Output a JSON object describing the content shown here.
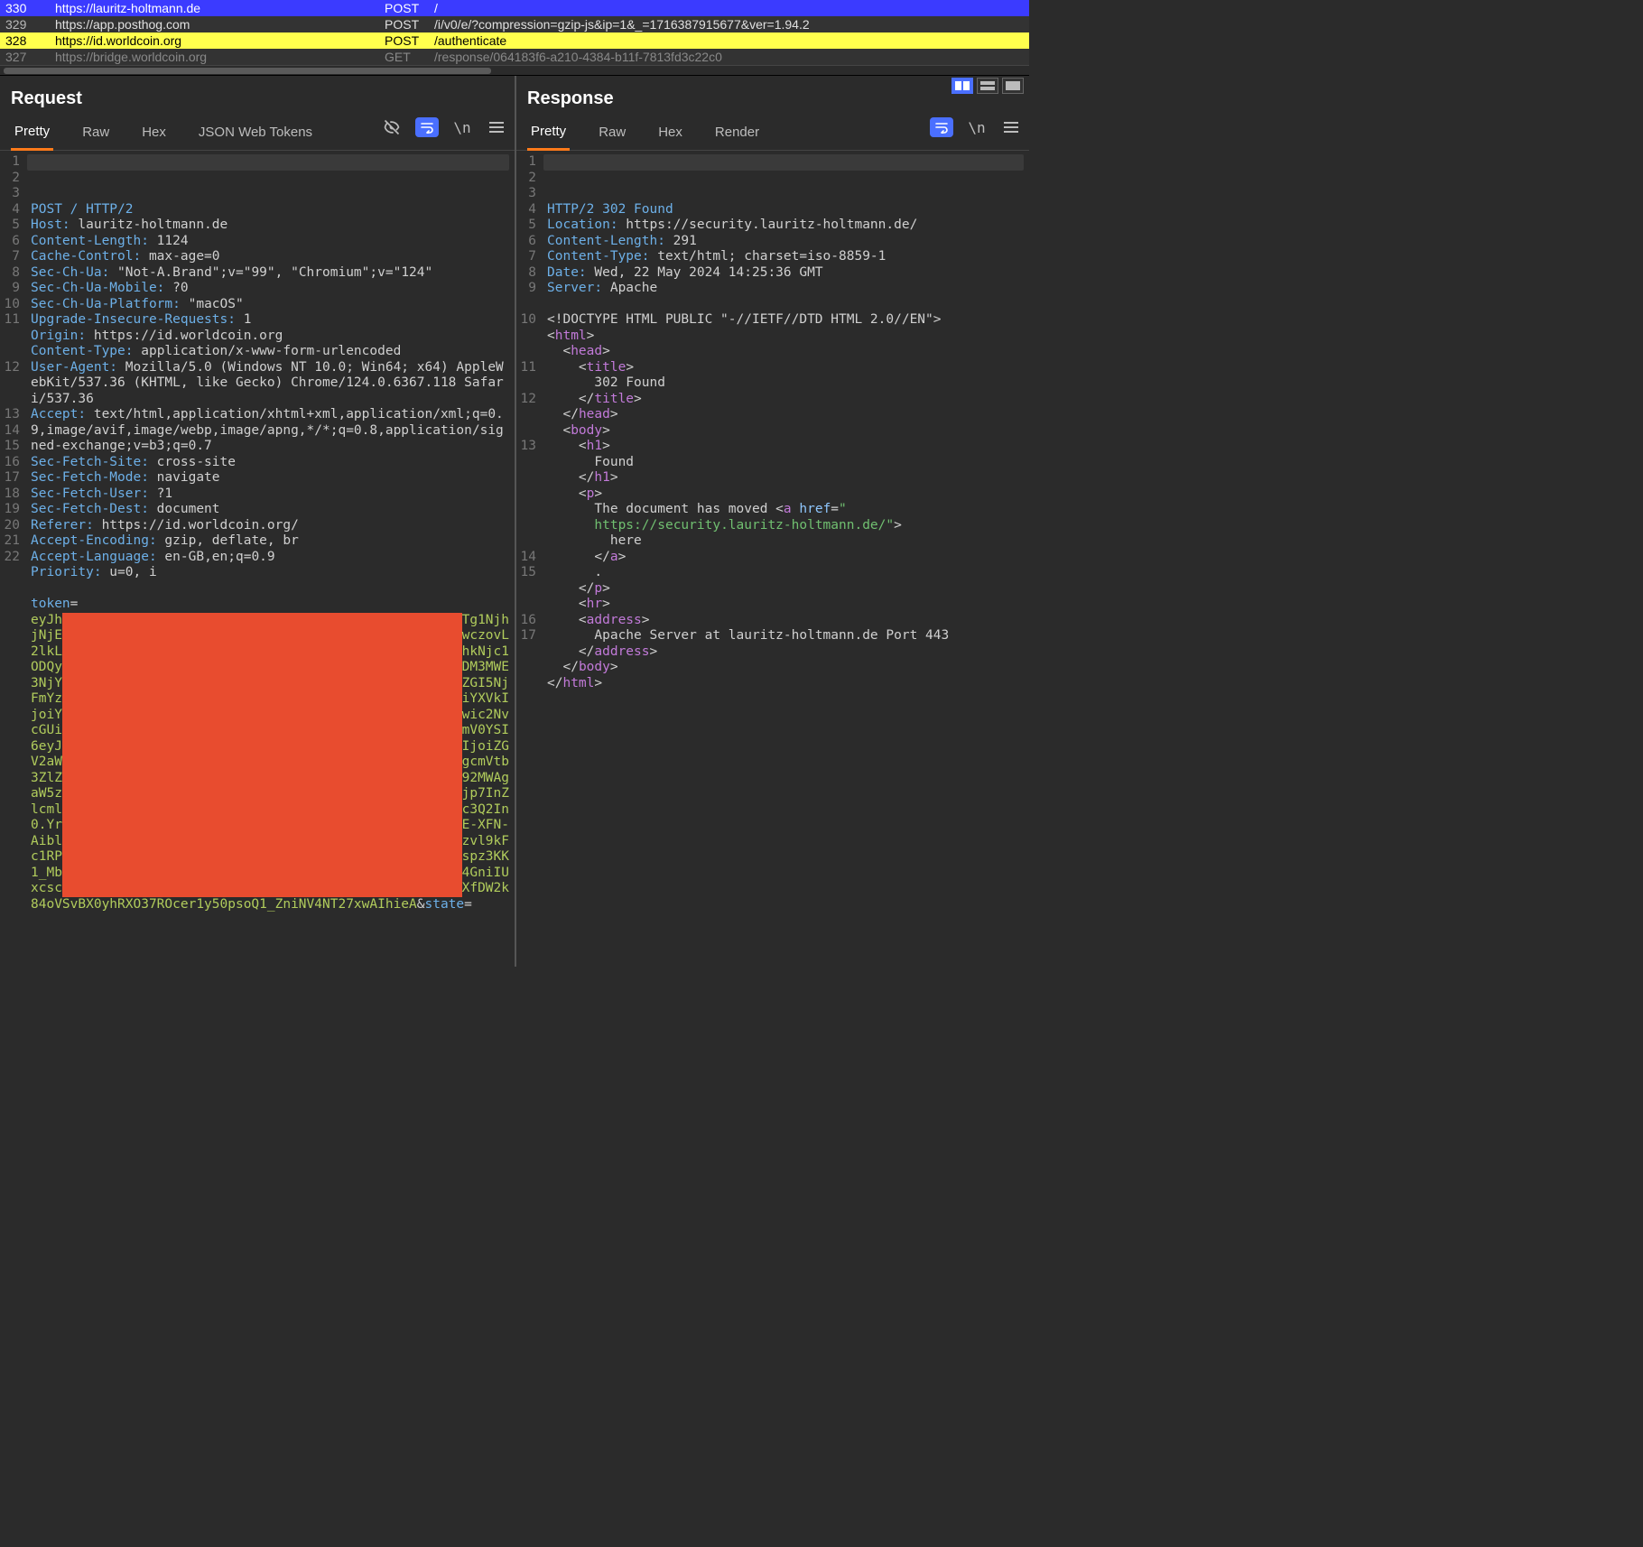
{
  "traffic": {
    "rows": [
      {
        "id": "330",
        "host": "https://lauritz-holtmann.de",
        "method": "POST",
        "path": "/",
        "style": "blue"
      },
      {
        "id": "329",
        "host": "https://app.posthog.com",
        "method": "POST",
        "path": "/i/v0/e/?compression=gzip-js&ip=1&_=1716387915677&ver=1.94.2",
        "style": "dark"
      },
      {
        "id": "328",
        "host": "https://id.worldcoin.org",
        "method": "POST",
        "path": "/authenticate",
        "style": "yellow"
      },
      {
        "id": "327",
        "host": "https://bridge.worldcoin.org",
        "method": "GET",
        "path": "/response/064183f6-a210-4384-b11f-7813fd3c22c0",
        "style": "cut"
      }
    ]
  },
  "request": {
    "title": "Request",
    "tabs": [
      "Pretty",
      "Raw",
      "Hex",
      "JSON Web Tokens"
    ],
    "line_numbers": [
      "1",
      "2",
      "3",
      "4",
      "5",
      "6",
      "7",
      "8",
      "9",
      "10",
      "11",
      "",
      "",
      "12",
      "",
      "",
      "13",
      "14",
      "15",
      "16",
      "17",
      "18",
      "19",
      "20",
      "21",
      "22"
    ],
    "first_line": "POST / HTTP/2",
    "headers": [
      {
        "k": "Host",
        "v": "lauritz-holtmann.de"
      },
      {
        "k": "Content-Length",
        "v": "1124"
      },
      {
        "k": "Cache-Control",
        "v": "max-age=0"
      },
      {
        "k": "Sec-Ch-Ua",
        "v": "\"Not-A.Brand\";v=\"99\", \"Chromium\";v=\"124\""
      },
      {
        "k": "Sec-Ch-Ua-Mobile",
        "v": "?0"
      },
      {
        "k": "Sec-Ch-Ua-Platform",
        "v": "\"macOS\""
      },
      {
        "k": "Upgrade-Insecure-Requests",
        "v": "1"
      },
      {
        "k": "Origin",
        "v": "https://id.worldcoin.org"
      },
      {
        "k": "Content-Type",
        "v": "application/x-www-form-urlencoded"
      },
      {
        "k": "User-Agent",
        "v": "Mozilla/5.0 (Windows NT 10.0; Win64; x64) AppleWebKit/537.36 (KHTML, like Gecko) Chrome/124.0.6367.118 Safari/537.36"
      },
      {
        "k": "Accept",
        "v": "text/html,application/xhtml+xml,application/xml;q=0.9,image/avif,image/webp,image/apng,*/*;q=0.8,application/signed-exchange;v=b3;q=0.7"
      },
      {
        "k": "Sec-Fetch-Site",
        "v": "cross-site"
      },
      {
        "k": "Sec-Fetch-Mode",
        "v": "navigate"
      },
      {
        "k": "Sec-Fetch-User",
        "v": "?1"
      },
      {
        "k": "Sec-Fetch-Dest",
        "v": "document"
      },
      {
        "k": "Referer",
        "v": "https://id.worldcoin.org/"
      },
      {
        "k": "Accept-Encoding",
        "v": "gzip, deflate, br"
      },
      {
        "k": "Accept-Language",
        "v": "en-GB,en;q=0.9"
      },
      {
        "k": "Priority",
        "v": "u=0, i"
      }
    ],
    "body_prefix": "token=",
    "token_lines_left": [
      "eyJh",
      "jNjE",
      "2lkL",
      "ODQy",
      "3NjY",
      "FmYz",
      "joiY",
      "cGUi",
      "6eyJ",
      "V2aW",
      "3ZlZ",
      "aW5z",
      "lcml",
      "0.Yr",
      "Aibl",
      "c1RP",
      "1_Mb",
      "xcsc"
    ],
    "token_lines_right": [
      "Tg1Njh",
      "wczovL",
      "hkNjc1",
      "DM3MWE",
      "ZGI5Nj",
      "iYXVkI",
      "wic2Nv",
      "mV0YSI",
      "IjoiZG",
      "gcmVtb",
      "92MWAg",
      "jp7InZ",
      "c3Q2In",
      "E-XFN-",
      "zvl9kF",
      "spz3KK",
      "4GniIU",
      "XfDW2k"
    ],
    "token_last_line": "84oVSvBX0yhRXO37ROcer1y50psoQ1_ZniNV4NT27xwAIhieA",
    "body_suffix": "&state="
  },
  "response": {
    "title": "Response",
    "tabs": [
      "Pretty",
      "Raw",
      "Hex",
      "Render"
    ],
    "line_numbers": [
      "1",
      "2",
      "3",
      "4",
      "5",
      "6",
      "7",
      "8",
      "9",
      "",
      "10",
      "",
      "",
      "11",
      "",
      "12",
      "",
      "",
      "13",
      "",
      "",
      "",
      "",
      "",
      "",
      "14",
      "15",
      "",
      "",
      "16",
      "17"
    ],
    "status_line": "HTTP/2 302 Found",
    "headers": [
      {
        "k": "Location",
        "v": "https://security.lauritz-holtmann.de/"
      },
      {
        "k": "Content-Length",
        "v": "291"
      },
      {
        "k": "Content-Type",
        "v": "text/html; charset=iso-8859-1"
      },
      {
        "k": "Date",
        "v": "Wed, 22 May 2024 14:25:36 GMT"
      },
      {
        "k": "Server",
        "v": "Apache"
      }
    ],
    "html": {
      "doctype": "<!DOCTYPE HTML PUBLIC \"-//IETF//DTD HTML 2.0//EN\">",
      "title_text": "302 Found",
      "h1_text": "Found",
      "p_text": "The document has moved ",
      "a_href": "https://security.lauritz-holtmann.de/",
      "a_text": "here",
      "address_text": "Apache Server at lauritz-holtmann.de Port 443"
    }
  },
  "icons": {
    "newline": "\\n"
  }
}
